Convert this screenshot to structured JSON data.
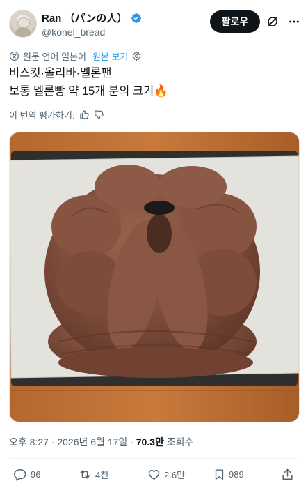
{
  "author": {
    "display_name": "Ran （パンの人）",
    "handle": "@konel_bread",
    "verified": true,
    "avatar_icon": "avatar-image"
  },
  "header": {
    "follow_label": "팔로우",
    "grok_icon": "grok-icon",
    "more_icon": "more-icon"
  },
  "translation": {
    "note": "원문 언어 일본어",
    "show_original": "원본 보기",
    "icon": "translate-icon",
    "settings_icon": "gear-icon"
  },
  "tweet": {
    "line1": "비스킷·올리바·멜론팬",
    "line2": "보통 멜론빵 약 15개 분의 크기🔥"
  },
  "rate": {
    "label": "이 번역 평가하기:",
    "up_icon": "thumbs-up-icon",
    "down_icon": "thumbs-down-icon"
  },
  "meta": {
    "time": "오후 8:27",
    "date": "2026년 6월 17일",
    "views_value": "70.3만",
    "views_label": "조회수"
  },
  "actions": {
    "replies": "96",
    "retweets": "4천",
    "likes": "2.6만",
    "bookmarks": "989"
  },
  "colors": {
    "accent": "#1d9bf0",
    "text": "#0f1419",
    "muted": "#536471",
    "follow_bg": "#0f1419"
  }
}
